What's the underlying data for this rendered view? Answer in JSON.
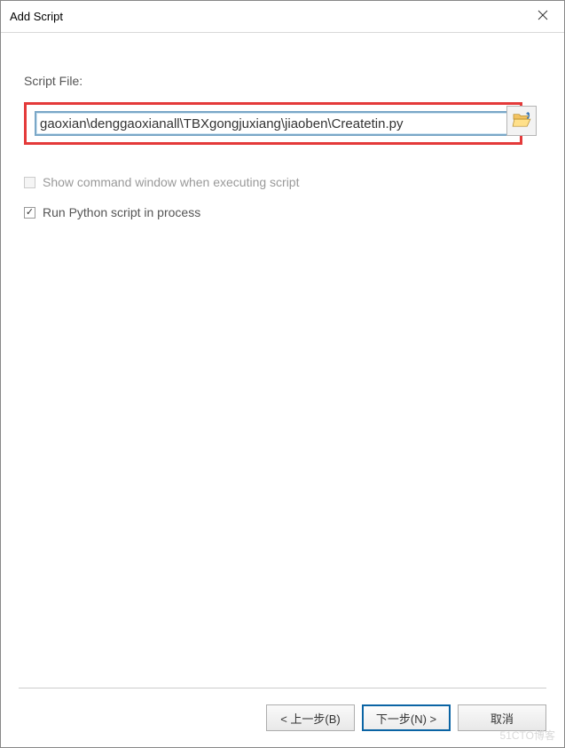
{
  "window": {
    "title": "Add Script"
  },
  "form": {
    "script_file_label": "Script File:",
    "script_file_value": "gaoxian\\denggaoxianall\\TBXgongjuxiang\\jiaoben\\Createtin.py"
  },
  "options": {
    "show_command_label": "Show command window when executing script",
    "show_command_checked": false,
    "show_command_enabled": false,
    "run_in_process_label": "Run Python script in process",
    "run_in_process_checked": true
  },
  "buttons": {
    "back": "< 上一步(B)",
    "next": "下一步(N) >",
    "cancel": "取消"
  },
  "watermark": "51CTO博客",
  "icons": {
    "close": "close-icon",
    "browse": "folder-open-icon"
  }
}
